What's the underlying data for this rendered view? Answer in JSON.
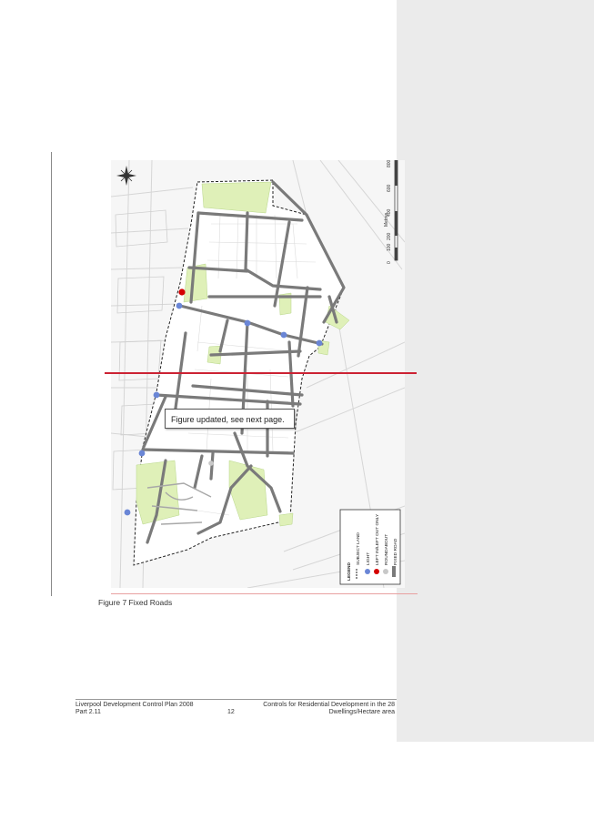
{
  "callout": {
    "text": "Figure updated, see next page."
  },
  "figure": {
    "caption": "Figure 7  Fixed Roads"
  },
  "map": {
    "scale_title": "Metres",
    "scale_ticks": [
      "0",
      "100",
      "200",
      "400",
      "600",
      "800"
    ],
    "legend": {
      "title": "LEGEND",
      "items": [
        {
          "label": "SUBJECT LAND",
          "symbol": "dashed-boundary"
        },
        {
          "label": "LIGHT",
          "symbol": "blue-dot"
        },
        {
          "label": "LEFT IN/LEFT OUT ONLY",
          "symbol": "red-dot"
        },
        {
          "label": "ROUNDABOUT",
          "symbol": "grey-dot"
        },
        {
          "label": "FIXED ROAD",
          "symbol": "grey-bar"
        }
      ]
    },
    "colors": {
      "fixed_road": "#7a7a7a",
      "light": "#6a86d6",
      "left_in_out": "#d40000",
      "roundabout": "#c8c8c8",
      "open_space": "#dff0b8"
    }
  },
  "footer": {
    "left_line1": "Liverpool Development Control Plan 2008",
    "left_line2": "Part 2.11",
    "page_number": "12",
    "right_line1": "Controls for Residential Development in the 28",
    "right_line2": "Dwellings/Hectare area"
  }
}
